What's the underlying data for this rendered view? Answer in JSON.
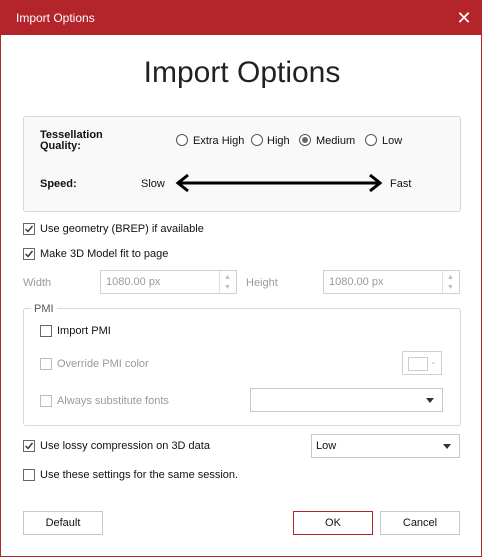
{
  "window": {
    "title": "Import Options",
    "close_glyph": "✕"
  },
  "heading": "Import Options",
  "tessellation": {
    "label": "Tessellation Quality:",
    "options": [
      {
        "label": "Extra High",
        "selected": false
      },
      {
        "label": "High",
        "selected": false
      },
      {
        "label": "Medium",
        "selected": true
      },
      {
        "label": "Low",
        "selected": false
      }
    ]
  },
  "speed": {
    "label": "Speed:",
    "slow": "Slow",
    "fast": "Fast"
  },
  "options": {
    "use_brep": {
      "label": "Use geometry (BREP) if available",
      "checked": true
    },
    "fit_page": {
      "label": "Make 3D Model fit to page",
      "checked": true
    }
  },
  "size": {
    "width_label": "Width",
    "width_value": "1080.00 px",
    "height_label": "Height",
    "height_value": "1080.00 px"
  },
  "pmi": {
    "legend": "PMI",
    "import": {
      "label": "Import PMI",
      "checked": false
    },
    "override": {
      "label": "Override PMI color",
      "checked": false
    },
    "substitute": {
      "label": "Always substitute fonts",
      "checked": false
    }
  },
  "compression": {
    "label": "Use lossy compression on 3D data",
    "checked": true,
    "value": "Low"
  },
  "session": {
    "label": "Use these settings for the same session.",
    "checked": false
  },
  "buttons": {
    "default": "Default",
    "ok": "OK",
    "cancel": "Cancel"
  },
  "colors": {
    "accent": "#b3242b"
  }
}
